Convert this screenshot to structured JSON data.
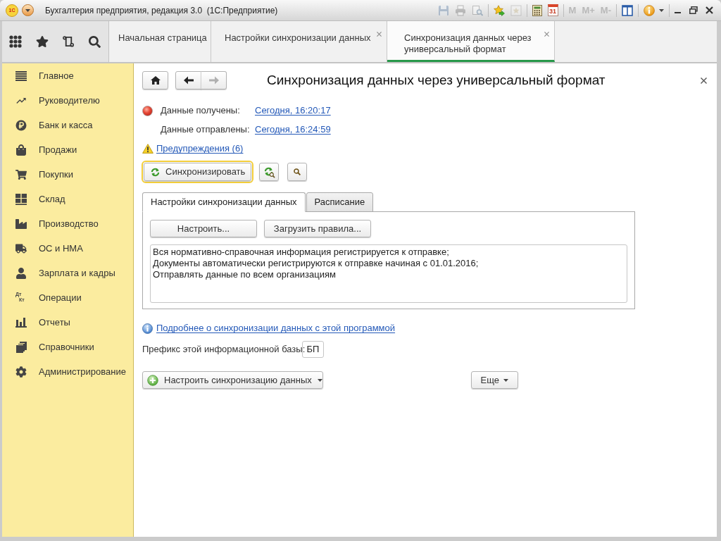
{
  "window": {
    "logo": "1С",
    "title": "Бухгалтерия предприятия, редакция 3.0  (1С:Предприятие)",
    "toolbar_groups": [
      {
        "items": [
          {
            "kind": "save",
            "disabled": true
          },
          {
            "kind": "print",
            "disabled": true
          },
          {
            "kind": "preview",
            "disabled": true
          }
        ]
      },
      {
        "items": [
          {
            "kind": "bookmark",
            "disabled": false
          },
          {
            "kind": "favorites",
            "disabled": true
          }
        ]
      },
      {
        "items": [
          {
            "kind": "calculator",
            "disabled": false
          },
          {
            "kind": "calendar",
            "label": "31",
            "disabled": false
          }
        ]
      },
      {
        "items": [
          {
            "kind": "memory",
            "label": "M",
            "disabled": true
          },
          {
            "kind": "memory",
            "label": "M+",
            "disabled": true
          },
          {
            "kind": "memory",
            "label": "M-",
            "disabled": true
          }
        ]
      },
      {
        "items": [
          {
            "kind": "panels",
            "disabled": false
          }
        ]
      },
      {
        "items": [
          {
            "kind": "help",
            "disabled": false
          }
        ]
      }
    ]
  },
  "tabs": [
    {
      "label": "Начальная страница",
      "selected": false,
      "closable": false
    },
    {
      "label": "Настройки синхронизации данных",
      "selected": false,
      "closable": true
    },
    {
      "label": "Синхронизация данных через универсальный формат",
      "selected": true,
      "closable": true
    }
  ],
  "sidebar": {
    "items": [
      {
        "kind": "main",
        "label": "Главное"
      },
      {
        "kind": "manager",
        "label": "Руководителю"
      },
      {
        "kind": "bank",
        "label": "Банк и касса"
      },
      {
        "kind": "sales",
        "label": "Продажи"
      },
      {
        "kind": "purchases",
        "label": "Покупки"
      },
      {
        "kind": "warehouse",
        "label": "Склад"
      },
      {
        "kind": "production",
        "label": "Производство"
      },
      {
        "kind": "assets",
        "label": "ОС и НМА"
      },
      {
        "kind": "salary",
        "label": "Зарплата и кадры"
      },
      {
        "kind": "operations",
        "label": "Операции",
        "icon_text": [
          "Дт",
          "Кт"
        ]
      },
      {
        "kind": "reports",
        "label": "Отчеты"
      },
      {
        "kind": "catalogs",
        "label": "Справочники"
      },
      {
        "kind": "admin",
        "label": "Администрирование"
      }
    ]
  },
  "form": {
    "title": "Синхронизация данных через универсальный формат",
    "navigation": [
      {
        "kind": "back",
        "disabled": false
      },
      {
        "kind": "forward",
        "disabled": true
      }
    ],
    "exchange": [
      {
        "label": "Данные получены:",
        "value": "Сегодня, 16:20:17",
        "error": true
      },
      {
        "label": "Данные отправлены:",
        "value": "Сегодня, 16:24:59",
        "error": false
      }
    ],
    "warnings_link": "Предупреждения (6)",
    "sync_button": {
      "label": "Синхронизировать",
      "focused": true
    },
    "tabs": [
      {
        "label": "Настройки синхронизации данных",
        "selected": true
      },
      {
        "label": "Расписание",
        "selected": false
      }
    ],
    "settings_buttons": [
      "Настроить...",
      "Загрузить правила..."
    ],
    "settings_summary": [
      "Вся нормативно-справочная информация регистрируется к отправке;",
      "Документы автоматически регистрируются к отправке начиная с 01.01.2016;",
      "Отправлять данные по всем организациям"
    ],
    "info_link": "Подробнее о синхронизации данных с этой программой",
    "prefix": {
      "label": "Префикс этой информационной базы:",
      "value": "БП"
    },
    "bottom_buttons": [
      {
        "kind": "add",
        "label": "Настроить синхронизацию данных"
      },
      {
        "kind": "more",
        "label": "Еще"
      }
    ]
  }
}
